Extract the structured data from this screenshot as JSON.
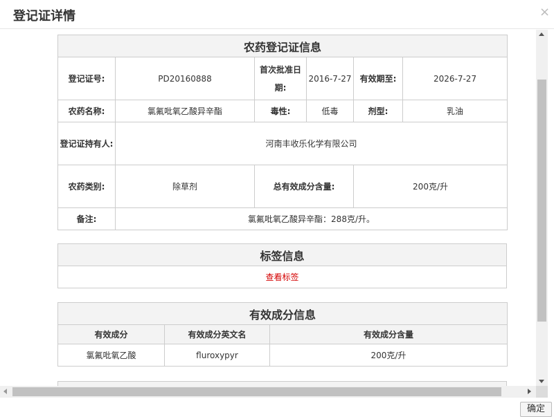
{
  "dialog": {
    "title": "登记证详情",
    "close_symbol": "×",
    "ok_label": "确定"
  },
  "registration": {
    "section_title": "农药登记证信息",
    "reg_no_label": "登记证号:",
    "reg_no": "PD20160888",
    "first_approval_label": "首次批准日期:",
    "first_approval": "2016-7-27",
    "valid_until_label": "有效期至:",
    "valid_until": "2026-7-27",
    "name_label": "农药名称:",
    "name": "氯氟吡氧乙酸异辛酯",
    "toxicity_label": "毒性:",
    "toxicity": "低毒",
    "formulation_label": "剂型:",
    "formulation": "乳油",
    "holder_label": "登记证持有人:",
    "holder": "河南丰收乐化学有限公司",
    "category_label": "农药类别:",
    "category": "除草剂",
    "total_content_label": "总有效成分含量:",
    "total_content": "200克/升",
    "remarks_label": "备注:",
    "remarks": "氯氟吡氧乙酸异辛酯：288克/升。"
  },
  "label_info": {
    "section_title": "标签信息",
    "view_label_link": "查看标签"
  },
  "ingredients": {
    "section_title": "有效成分信息",
    "headers": [
      "有效成分",
      "有效成分英文名",
      "有效成分含量"
    ],
    "rows": [
      {
        "name": "氯氟吡氧乙酸",
        "english": "fluroxypyr",
        "content": "200克/升"
      }
    ]
  }
}
